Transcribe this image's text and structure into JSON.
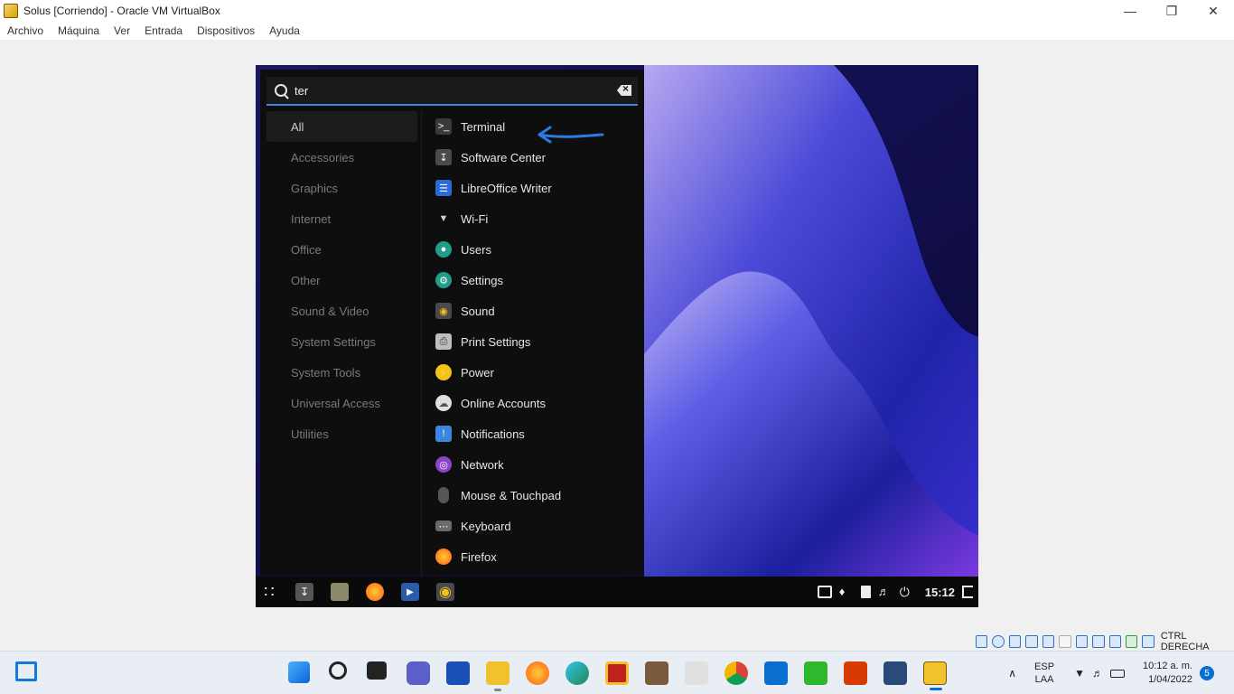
{
  "window": {
    "title": "Solus [Corriendo] - Oracle VM VirtualBox",
    "menu": [
      "Archivo",
      "Máquina",
      "Ver",
      "Entrada",
      "Dispositivos",
      "Ayuda"
    ]
  },
  "search": {
    "value": "ter",
    "placeholder": ""
  },
  "categories": [
    "All",
    "Accessories",
    "Graphics",
    "Internet",
    "Office",
    "Other",
    "Sound & Video",
    "System Settings",
    "System Tools",
    "Universal Access",
    "Utilities"
  ],
  "active_category": "All",
  "apps": [
    {
      "label": "Terminal",
      "icon": "terminal-icon",
      "color": "#3a3a3a"
    },
    {
      "label": "Software Center",
      "icon": "software-center-icon",
      "color": "#4a4a4a"
    },
    {
      "label": "LibreOffice Writer",
      "icon": "writer-icon",
      "color": "#2a6bd8"
    },
    {
      "label": "Wi-Fi",
      "icon": "wifi-icon",
      "color": "#d0d0d0"
    },
    {
      "label": "Users",
      "icon": "users-icon",
      "color": "#1f9e8a"
    },
    {
      "label": "Settings",
      "icon": "settings-icon",
      "color": "#1f9e8a"
    },
    {
      "label": "Sound",
      "icon": "sound-icon",
      "color": "#4a4a4a"
    },
    {
      "label": "Print Settings",
      "icon": "printer-icon",
      "color": "#bdbdbd"
    },
    {
      "label": "Power",
      "icon": "power-icon",
      "color": "#f2c31b"
    },
    {
      "label": "Online Accounts",
      "icon": "cloud-icon",
      "color": "#e0e0e0"
    },
    {
      "label": "Notifications",
      "icon": "notifications-icon",
      "color": "#3b86e0"
    },
    {
      "label": "Network",
      "icon": "network-icon",
      "color": "#8e44c9"
    },
    {
      "label": "Mouse & Touchpad",
      "icon": "mouse-icon",
      "color": "#555555"
    },
    {
      "label": "Keyboard",
      "icon": "keyboard-icon",
      "color": "#6a6a6a"
    },
    {
      "label": "Firefox",
      "icon": "firefox-icon",
      "color": "#ff7a1a"
    }
  ],
  "guest_panel": {
    "clock": "15:12"
  },
  "host_key": "CTRL DERECHA",
  "taskbar": {
    "language": "ESP",
    "layout": "LAA",
    "time": "10:12 a. m.",
    "date": "1/04/2022",
    "notifications": "5"
  }
}
